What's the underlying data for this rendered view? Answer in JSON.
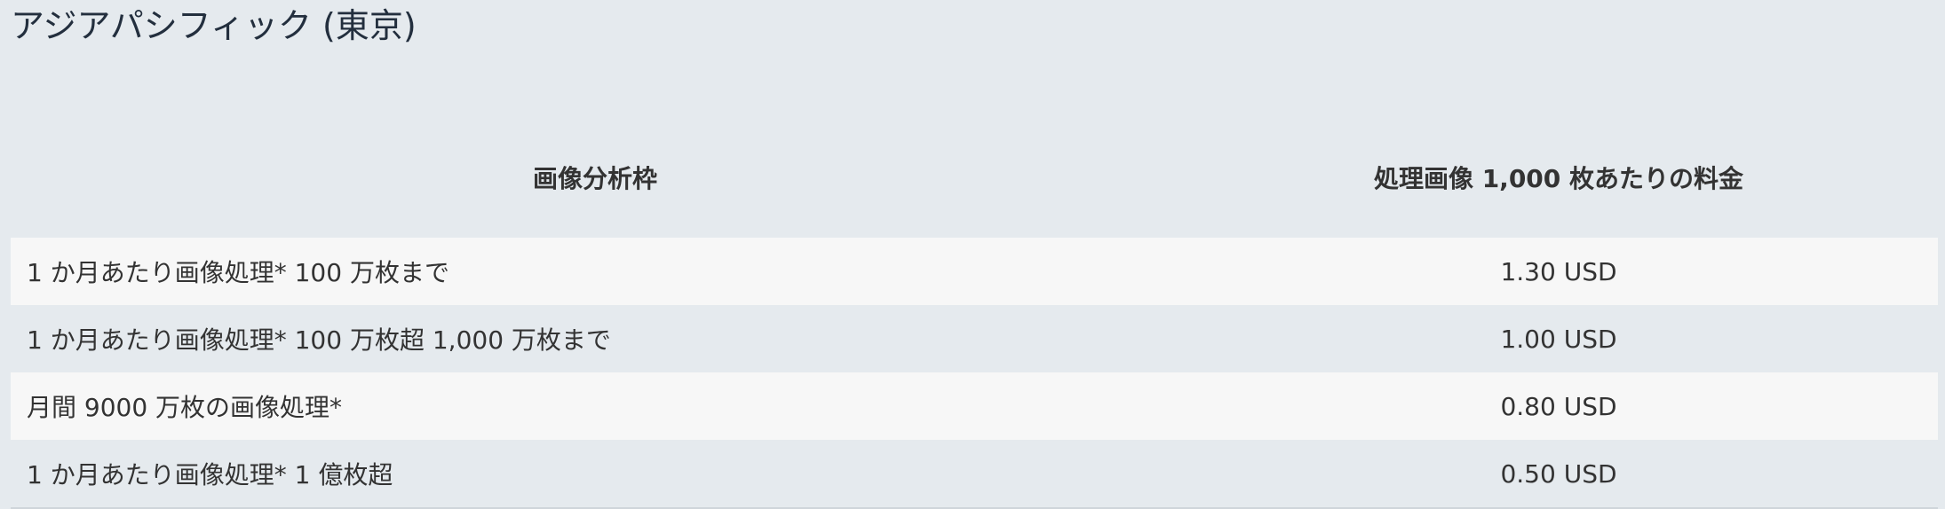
{
  "region": {
    "title": "アジアパシフィック (東京)"
  },
  "table": {
    "headers": [
      "画像分析枠",
      "処理画像 1,000 枚あたりの料金"
    ],
    "rows": [
      {
        "tier": "1 か月あたり画像処理* 100 万枚まで",
        "price": "1.30 USD"
      },
      {
        "tier": "1 か月あたり画像処理* 100 万枚超 1,000 万枚まで",
        "price": "1.00 USD"
      },
      {
        "tier": "月間 9000 万枚の画像処理*",
        "price": "0.80 USD"
      },
      {
        "tier": "1 か月あたり画像処理* 1 億枚超",
        "price": "0.50 USD"
      }
    ]
  },
  "colors": {
    "background": "#e5eaee",
    "row_light": "#f7f7f7",
    "text": "#333333"
  }
}
